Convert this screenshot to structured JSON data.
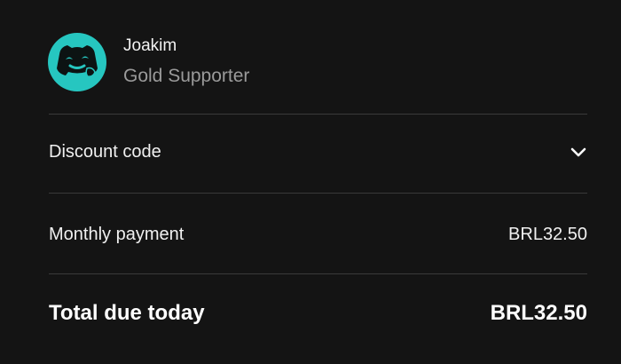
{
  "member": {
    "name": "Joakim",
    "tier": "Gold Supporter",
    "avatar_color": "#26c6c0",
    "avatar_icon": "smiling-face-icon"
  },
  "discount": {
    "label": "Discount code",
    "expand_icon": "chevron-down-icon"
  },
  "monthly": {
    "label": "Monthly payment",
    "amount": "BRL32.50"
  },
  "total": {
    "label": "Total due today",
    "amount": "BRL32.50"
  },
  "colors": {
    "background": "#141414",
    "divider": "#3a3a3a",
    "secondary_text": "#9a9a9a",
    "accent": "#26c6c0"
  }
}
